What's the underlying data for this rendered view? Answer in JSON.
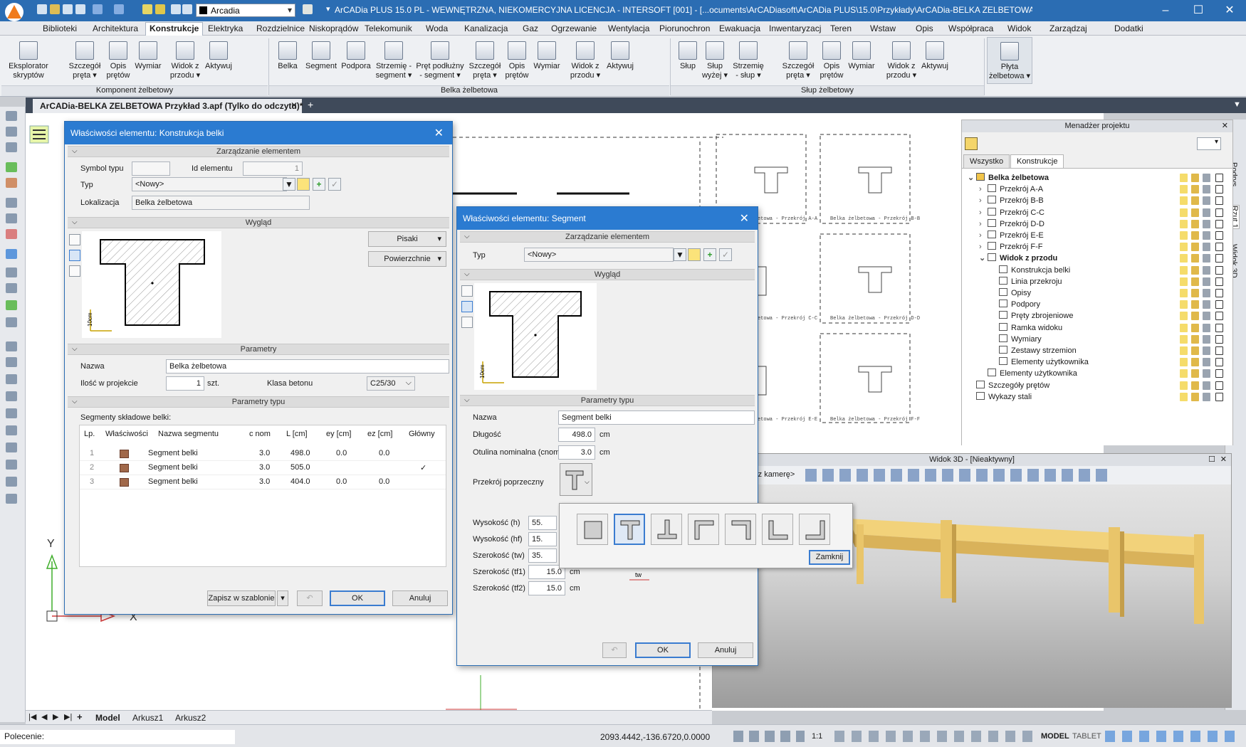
{
  "window": {
    "title": "ArCADia PLUS 15.0 PL - WEWNĘTRZNA, NIEKOMERCYJNA LICENCJA - INTERSOFT [001] - [...ocuments\\ArCADiasoft\\ArCADia PLUS\\15.0\\Przykłady\\ArCADia-BELKA ZELBETOWA Prz]",
    "layer_combo": "Arcadia"
  },
  "menu": [
    "Biblioteki",
    "Architektura",
    "Konstrukcje",
    "Elektryka",
    "Rozdzielnice",
    "Niskoprądów",
    "Telekomunik",
    "Woda",
    "Kanalizacja",
    "Gaz",
    "Ogrzewanie",
    "Wentylacja",
    "Piorunochron",
    "Ewakuacja",
    "Inwentaryzacj",
    "Teren",
    "Wstaw",
    "Opis",
    "Współpraca",
    "Widok",
    "Zarządzaj",
    "Dodatki"
  ],
  "ribbon": {
    "groups": [
      "Komponent żelbetowy",
      "Belka żelbetowa",
      "Słup żelbetowy"
    ],
    "buttons": [
      "Eksplorator skryptów",
      "Szczegół pręta ▾",
      "Opis prętów",
      "Wymiar",
      "Widok z przodu ▾",
      "Aktywuj",
      "Belka",
      "Segment",
      "Podpora",
      "Strzemię - segment ▾",
      "Pręt podłużny - segment ▾",
      "Szczegół pręta ▾",
      "Opis prętów",
      "Wymiar",
      "Widok z przodu ▾",
      "Aktywuj",
      "Słup",
      "Słup wyżej ▾",
      "Strzemię - słup ▾",
      "Szczegół pręta ▾",
      "Opis prętów",
      "Wymiar",
      "Widok z przodu ▾",
      "Aktywuj",
      "Płyta żelbetowa ▾"
    ]
  },
  "doc_tab": "ArCADia-BELKA ZELBETOWA Przykład 3.apf (Tylko do odczytu)*",
  "dialog1": {
    "title": "Właściwości elementu: Konstrukcja belki",
    "sec_manage": "Zarządzanie elementem",
    "symbol_label": "Symbol typu",
    "id_label": "Id elementu",
    "id_value": "1",
    "type_label": "Typ",
    "type_value": "<Nowy>",
    "loc_label": "Lokalizacja",
    "loc_value": "Belka żelbetowa",
    "sec_look": "Wygląd",
    "pens": "Pisaki",
    "surfaces": "Powierzchnie",
    "scale": "10cm",
    "sec_params": "Parametry",
    "name_label": "Nazwa",
    "name_value": "Belka żelbetowa",
    "qty_label": "Ilość w projekcie",
    "qty_value": "1",
    "qty_unit": "szt.",
    "class_label": "Klasa betonu",
    "class_value": "C25/30",
    "sec_type": "Parametry typu",
    "segments_label": "Segmenty składowe belki:",
    "table_headers": [
      "Lp.",
      "Właściwości",
      "Nazwa segmentu",
      "c nom",
      "L [cm]",
      "ey [cm]",
      "ez [cm]",
      "Główny"
    ],
    "rows": [
      {
        "lp": "1",
        "name": "Segment belki",
        "cnom": "3.0",
        "L": "498.0",
        "ey": "0.0",
        "ez": "0.0",
        "main": ""
      },
      {
        "lp": "2",
        "name": "Segment belki",
        "cnom": "3.0",
        "L": "505.0",
        "ey": "",
        "ez": "",
        "main": "✓"
      },
      {
        "lp": "3",
        "name": "Segment belki",
        "cnom": "3.0",
        "L": "404.0",
        "ey": "0.0",
        "ez": "0.0",
        "main": ""
      }
    ],
    "save_template": "Zapisz w szablonie",
    "ok": "OK",
    "cancel": "Anuluj"
  },
  "dialog2": {
    "title": "Właściwości elementu: Segment",
    "sec_manage": "Zarządzanie elementem",
    "type_label": "Typ",
    "type_value": "<Nowy>",
    "sec_look": "Wygląd",
    "scale": "10cm",
    "sec_type": "Parametry typu",
    "name_label": "Nazwa",
    "name_value": "Segment belki",
    "length_label": "Długość",
    "length_value": "498.0",
    "cover_label": "Otulina nominalna (cnom)",
    "cover_value": "3.0",
    "cs_label": "Przekrój poprzeczny",
    "h_label": "Wysokość (h)",
    "h_value": "55.",
    "hf_label": "Wysokość (hf)",
    "hf_value": "15.",
    "tw_label": "Szerokość (tw)",
    "tw_value": "35.",
    "tf1_label": "Szerokość (tf1)",
    "tf1_value": "15.0",
    "tf2_label": "Szerokość (tf2)",
    "tf2_value": "15.0",
    "unit": "cm",
    "ok": "OK",
    "cancel": "Anuluj"
  },
  "shape_popup": {
    "shapes": [
      "rect-section-icon",
      "t-section-icon",
      "inverted-t-section-icon",
      "l-top-left-section-icon",
      "l-top-right-section-icon",
      "l-bottom-left-section-icon",
      "l-bottom-right-section-icon"
    ],
    "close": "Zamknij",
    "tw_tag": "tw"
  },
  "project_manager": {
    "title": "Menadżer projektu",
    "tabs": [
      "Wszystko",
      "Konstrukcje"
    ],
    "tree": [
      {
        "label": "Belka żelbetowa",
        "level": 0,
        "bold": true,
        "exp": "⌄"
      },
      {
        "label": "Przekrój A-A",
        "level": 1,
        "exp": "›"
      },
      {
        "label": "Przekrój B-B",
        "level": 1,
        "exp": "›"
      },
      {
        "label": "Przekrój C-C",
        "level": 1,
        "exp": "›"
      },
      {
        "label": "Przekrój D-D",
        "level": 1,
        "exp": "›"
      },
      {
        "label": "Przekrój E-E",
        "level": 1,
        "exp": "›"
      },
      {
        "label": "Przekrój F-F",
        "level": 1,
        "exp": "›"
      },
      {
        "label": "Widok z przodu",
        "level": 1,
        "bold": true,
        "exp": "⌄"
      },
      {
        "label": "Konstrukcja belki",
        "level": 2
      },
      {
        "label": "Linia przekroju",
        "level": 2
      },
      {
        "label": "Opisy",
        "level": 2
      },
      {
        "label": "Podpory",
        "level": 2
      },
      {
        "label": "Pręty zbrojeniowe",
        "level": 2
      },
      {
        "label": "Ramka widoku",
        "level": 2
      },
      {
        "label": "Wymiary",
        "level": 2
      },
      {
        "label": "Zestawy strzemion",
        "level": 2
      },
      {
        "label": "Elementy użytkownika",
        "level": 2
      },
      {
        "label": "Elementy użytkownika",
        "level": 1
      },
      {
        "label": "Szczegóły prętów",
        "level": 0
      },
      {
        "label": "Wykazy stali",
        "level": 0
      }
    ]
  },
  "view3d": {
    "title": "Widok 3D - [Nieaktywny]",
    "camera": "rz kamerę>"
  },
  "drawing_labels": [
    "Belka żelbetowa - Przekrój A-A",
    "Belka żelbetowa - Przekrój B-B",
    "Belka żelbetowa - Przekrój C-C",
    "Belka żelbetowa - Przekrój D-D",
    "Belka żelbetowa - Przekrój E-E",
    "Belka żelbetowa - Przekrój F-F"
  ],
  "canvas_axis": {
    "y": "Y",
    "x": "X"
  },
  "sheets": [
    "Model",
    "Arkusz1",
    "Arkusz2"
  ],
  "right_tabs": [
    "Podrys",
    "Rzut 1",
    "Widok 3D"
  ],
  "status": {
    "prompt": "Polecenie:",
    "coords": "2093.4442,-136.6720,0.0000",
    "scale": "1:1",
    "model": "MODEL",
    "tablet": "TABLET"
  }
}
